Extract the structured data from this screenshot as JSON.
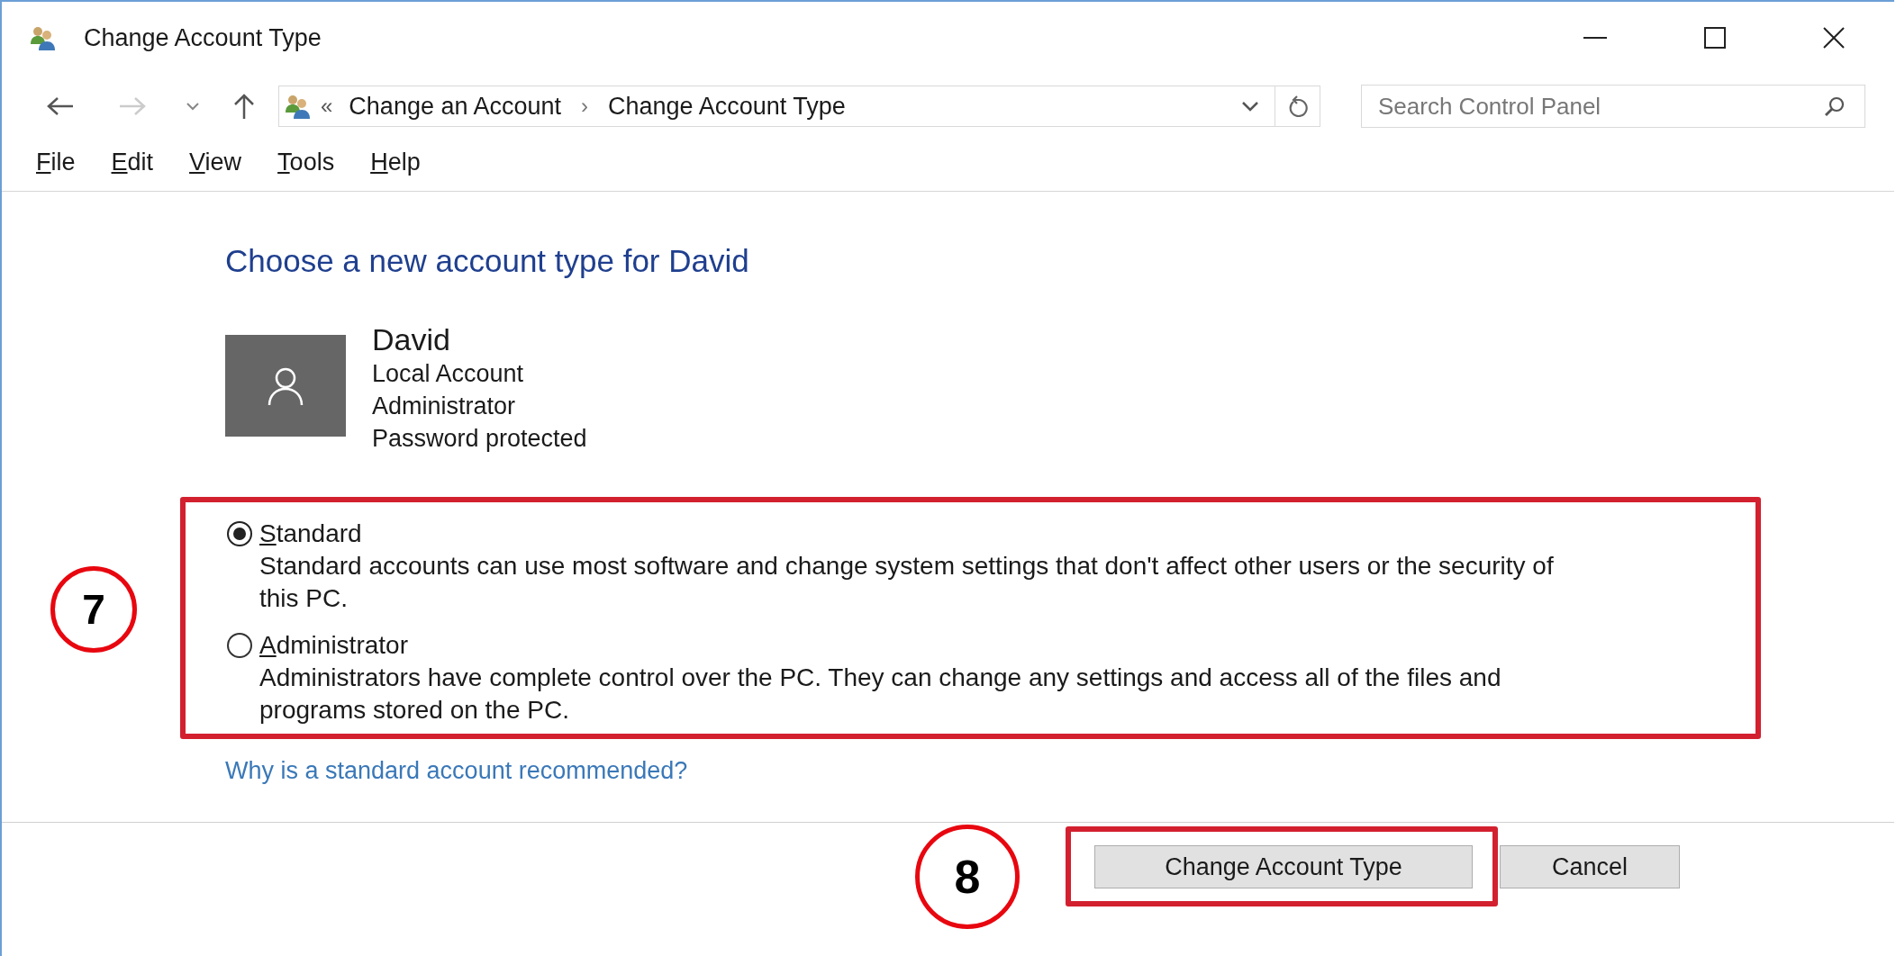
{
  "window": {
    "title": "Change Account Type"
  },
  "address_bar": {
    "overflow": "«",
    "separator": "›",
    "path": [
      {
        "label": "Change an Account"
      },
      {
        "label": "Change Account Type"
      }
    ]
  },
  "search": {
    "placeholder": "Search Control Panel"
  },
  "menu": [
    "File",
    "Edit",
    "View",
    "Tools",
    "Help"
  ],
  "heading": "Choose a new account type for David",
  "account": {
    "name": "David",
    "details": [
      "Local Account",
      "Administrator",
      "Password protected"
    ]
  },
  "account_types": [
    {
      "label": "Standard",
      "description": "Standard accounts can use most software and change system settings that don't affect other users or the security of this PC.",
      "selected": true
    },
    {
      "label": "Administrator",
      "description": "Administrators have complete control over the PC. They can change any settings and access all of the files and programs stored on the PC.",
      "selected": false
    }
  ],
  "link": "Why is a standard account recommended?",
  "buttons": [
    {
      "label": "Change Account Type",
      "highlighted": true
    },
    {
      "label": "Cancel",
      "highlighted": false
    }
  ],
  "annotations": [
    {
      "label": "7"
    },
    {
      "label": "8"
    }
  ]
}
